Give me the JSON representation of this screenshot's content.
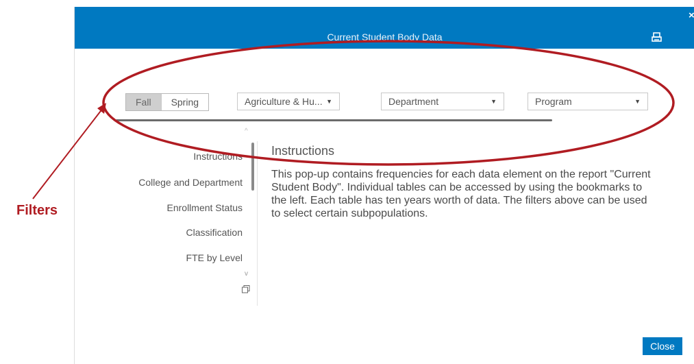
{
  "dialog": {
    "title": "Current Student Body Data",
    "close_x": "×",
    "close_button": "Close",
    "header_color": "#0079c1"
  },
  "filters": {
    "term_options": [
      "Fall",
      "Spring"
    ],
    "term_selected": "Fall",
    "college": "Agriculture & Hu...",
    "department": "Department",
    "program": "Program",
    "dropdown_icon": "▼"
  },
  "nav": {
    "items": [
      "Instructions",
      "College and Department",
      "Enrollment Status",
      "Classification",
      "FTE by Level"
    ],
    "up_icon": "^",
    "down_icon": "v"
  },
  "content": {
    "title": "Instructions",
    "body": "This pop-up contains frequencies for each data element on the report \"Current Student Body\".  Individual tables can be accessed by using the bookmarks to the left. Each table has ten years worth of data. The filters above can be used to select certain subpopulations."
  },
  "annotation": {
    "label": "Filters",
    "color": "#b01c22"
  }
}
